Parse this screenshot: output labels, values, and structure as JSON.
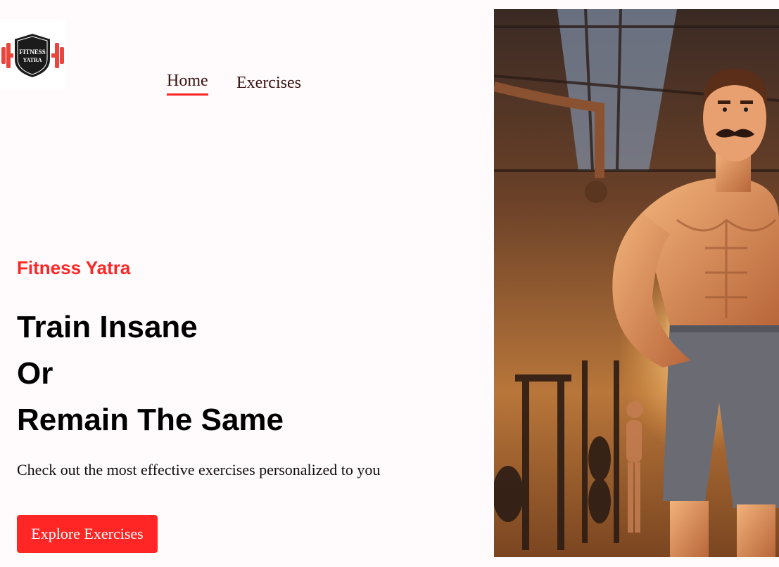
{
  "navbar": {
    "logo_text_line1": "FITNESS",
    "logo_text_line2": "YATRA",
    "links": [
      {
        "label": "Home",
        "active": true
      },
      {
        "label": "Exercises",
        "active": false
      }
    ]
  },
  "hero": {
    "brand": "Fitness Yatra",
    "headline_lines": [
      "Train Insane",
      "Or",
      "Remain The Same"
    ],
    "subtitle": "Check out the most effective exercises personalized to you",
    "cta_label": "Explore Exercises",
    "banner_image": "bodybuilder-in-gym-illustration"
  },
  "colors": {
    "accent": "#ff2625",
    "background": "#fffafb",
    "text": "#000000"
  }
}
